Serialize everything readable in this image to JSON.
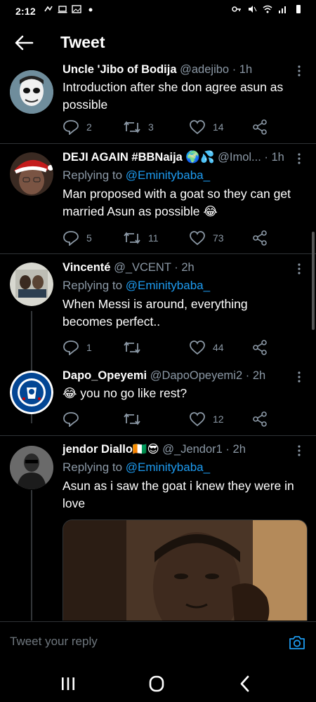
{
  "status_bar": {
    "time": "2:12"
  },
  "header": {
    "title": "Tweet"
  },
  "tweets": [
    {
      "name": "Uncle 'Jibo of Bodija",
      "handle": "@adejibo",
      "time": "1h",
      "text": "Introduction after she don agree asun as possible",
      "replies": "2",
      "retweets": "3",
      "likes": "14"
    },
    {
      "name": "DEJI AGAIN #BBNaija 🌍💦",
      "handle": "@Imol...",
      "time": "1h",
      "replying_prefix": "Replying to",
      "replying_to": "@Eminitybaba_",
      "text": "Man proposed with a goat so they can get married Asun as possible 😂",
      "replies": "5",
      "retweets": "11",
      "likes": "73"
    },
    {
      "name": "Vincenté",
      "handle": "@_VCENT",
      "time": "2h",
      "replying_prefix": "Replying to",
      "replying_to": "@Eminitybaba_",
      "text": "When Messi is around, everything becomes perfect..",
      "replies": "1",
      "retweets": "",
      "likes": "44"
    },
    {
      "name": "Dapo_Opeyemi",
      "handle": "@DapoOpeyemi2",
      "time": "2h",
      "text": "😂 you no go like rest?",
      "replies": "",
      "retweets": "",
      "likes": "12"
    },
    {
      "name": "jendor Diallo🇨🇮😎",
      "handle": "@_Jendor1",
      "time": "2h",
      "replying_prefix": "Replying to",
      "replying_to": "@Eminitybaba_",
      "text": "Asun as i saw the goat i knew they were in love"
    }
  ],
  "composer": {
    "placeholder": "Tweet your reply"
  },
  "colors": {
    "accent": "#1d9bf0",
    "background": "#000000",
    "muted": "#8b98a5",
    "divider": "#2f3336"
  },
  "icons": [
    "back-arrow-icon",
    "reply-icon",
    "retweet-icon",
    "like-icon",
    "share-icon",
    "more-icon",
    "camera-icon",
    "recent-apps-icon",
    "home-icon",
    "back-icon"
  ]
}
